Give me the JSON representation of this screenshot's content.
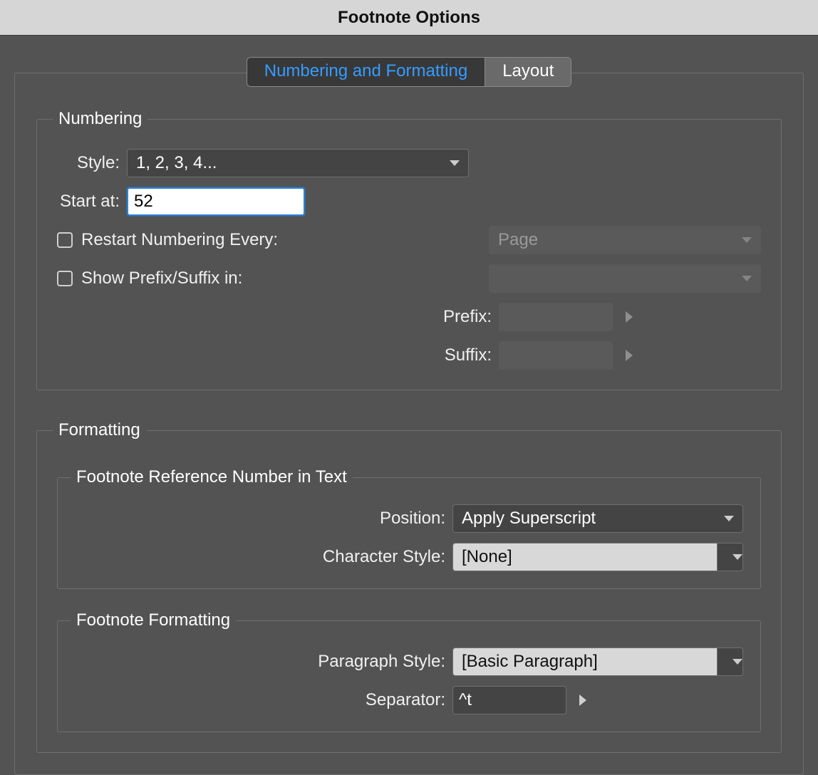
{
  "title": "Footnote Options",
  "tabs": {
    "numbering": "Numbering and Formatting",
    "layout": "Layout"
  },
  "numbering": {
    "legend": "Numbering",
    "style_label": "Style:",
    "style_value": "1, 2, 3, 4...",
    "start_at_label": "Start at:",
    "start_at_value": "52",
    "restart_label": "Restart Numbering Every:",
    "restart_value": "Page",
    "show_prefix_label": "Show Prefix/Suffix in:",
    "show_prefix_value": "",
    "prefix_label": "Prefix:",
    "prefix_value": "",
    "suffix_label": "Suffix:",
    "suffix_value": ""
  },
  "formatting": {
    "legend": "Formatting",
    "ref": {
      "legend": "Footnote Reference Number in Text",
      "position_label": "Position:",
      "position_value": "Apply Superscript",
      "char_style_label": "Character Style:",
      "char_style_value": "[None]"
    },
    "foot": {
      "legend": "Footnote Formatting",
      "para_style_label": "Paragraph Style:",
      "para_style_value": "[Basic Paragraph]",
      "separator_label": "Separator:",
      "separator_value": "^t"
    }
  }
}
